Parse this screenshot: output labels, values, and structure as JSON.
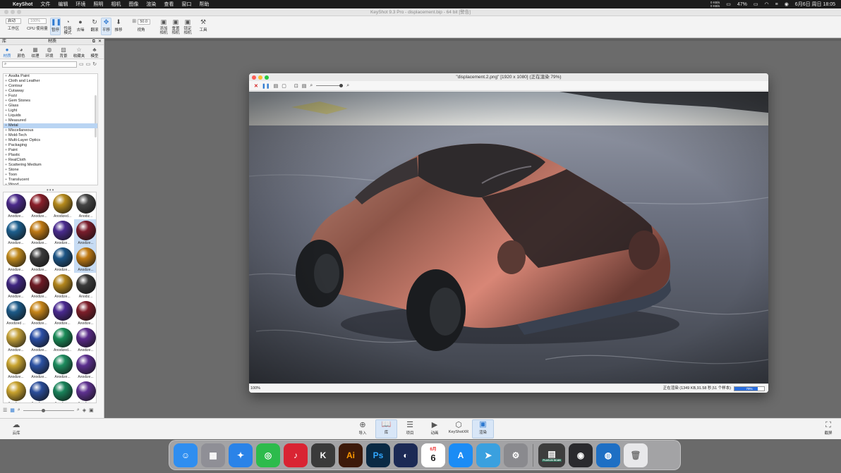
{
  "menubar": {
    "app": "KeyShot",
    "items": [
      "文件",
      "编辑",
      "环境",
      "照明",
      "相机",
      "图像",
      "渲染",
      "查看",
      "窗口",
      "帮助"
    ],
    "right": {
      "net_up": "0 KB/s",
      "net_down": "0 KB/s",
      "battery": "47%",
      "datetime": "6月6日 周日 18:05"
    }
  },
  "window": {
    "title": "KeyShot 9.3 Pro  - displacement.bip  - 64 bit [警告]"
  },
  "toolbar": {
    "workspace_select": "启动",
    "workspace_label": "工作区",
    "cpu_select": "100%",
    "cpu_label": "CPU 使用量",
    "pause_label": "暂停",
    "perf_label": "性能\n模式",
    "denoise_label": "去噪",
    "refresh_label": "翻滚",
    "pan_label": "平移",
    "push_label": "推移",
    "fov_value": "50.0",
    "fov_label": "视角",
    "add_camera_label": "添加\n相机",
    "reset_camera_label": "重置\n相机",
    "lock_camera_label": "锁定\n相机",
    "tools_label": "工具"
  },
  "library": {
    "header_left": "库",
    "header_center": "材质",
    "tabs": [
      "材质",
      "颜色",
      "纹理",
      "环境",
      "背景",
      "收藏夹",
      "模型"
    ],
    "search_placeholder": "",
    "tree": [
      "Axalta Paint",
      "Cloth and Leather",
      "Contour",
      "Cutaway",
      "Fuzz",
      "Gem Stones",
      "Glass",
      "Light",
      "Liquids",
      "Measured",
      "Metal",
      "Miscellaneous",
      "Mold-Tech",
      "Multi-Layer Optics",
      "Packaging",
      "Paint",
      "Plastic",
      "RealCloth",
      "Scattering Medium",
      "Stone",
      "Toon",
      "Translucent",
      "Wood"
    ],
    "selected_tree": "Metal",
    "thumbs": [
      {
        "label": "Anodize...",
        "color": "#4b2a8a"
      },
      {
        "label": "Anodize...",
        "color": "#8a1f2a"
      },
      {
        "label": "Anodized...",
        "color": "#b58a1c"
      },
      {
        "label": "Anodiz...",
        "color": "#444444"
      },
      {
        "label": "Anodize...",
        "color": "#1d5f8e"
      },
      {
        "label": "Anodize...",
        "color": "#c07a14"
      },
      {
        "label": "Anodize...",
        "color": "#4a2b8e"
      },
      {
        "label": "Anodize...",
        "color": "#7a1d2c"
      },
      {
        "label": "Anodize...",
        "color": "#c08a1e"
      },
      {
        "label": "Anodize...",
        "color": "#3b3b3b"
      },
      {
        "label": "Anodize...",
        "color": "#1d5484"
      },
      {
        "label": "Anodize...",
        "color": "#c07a12"
      },
      {
        "label": "Anodize...",
        "color": "#3f2680"
      },
      {
        "label": "Anodize...",
        "color": "#6e1a25"
      },
      {
        "label": "Anodize...",
        "color": "#b3861d"
      },
      {
        "label": "Anodiz...",
        "color": "#3a3a3a"
      },
      {
        "label": "Anodized ...",
        "color": "#1c5a88"
      },
      {
        "label": "Anodize...",
        "color": "#c88618"
      },
      {
        "label": "Anodize...",
        "color": "#4a2a90"
      },
      {
        "label": "Anodize...",
        "color": "#7d1e2a"
      },
      {
        "label": "Anodize...",
        "color": "#c5a23a"
      },
      {
        "label": "Anodize...",
        "color": "#2b4fa6"
      },
      {
        "label": "Anodized...",
        "color": "#1a8a57"
      },
      {
        "label": "Anodize...",
        "color": "#5a2a8a"
      },
      {
        "label": "Anodize...",
        "color": "#c9a531"
      },
      {
        "label": "Anodize...",
        "color": "#2c52a3"
      },
      {
        "label": "Anodize...",
        "color": "#1d8c5e"
      },
      {
        "label": "Anodize...",
        "color": "#5b2f8e"
      },
      {
        "label": "Anodize...",
        "color": "#c8a22e"
      },
      {
        "label": "Anodize...",
        "color": "#2a4d9a"
      },
      {
        "label": "Anodize...",
        "color": "#19835a"
      },
      {
        "label": "Anodize...",
        "color": "#5e3190"
      }
    ],
    "selected_thumbs": [
      7,
      11
    ]
  },
  "render_window": {
    "title": "\"displacement.2.png\" [1920 x 1080] (正在渲染 79%)",
    "zoom": "100%",
    "status": "正在渲染 (1349 KB,91.58 秒,51 个样本)",
    "progress_pct": 79,
    "progress_text": "79%"
  },
  "bottombar": {
    "cloud_label": "云库",
    "import_label": "导入",
    "library_label": "库",
    "project_label": "项目",
    "animation_label": "动画",
    "keyshotxr_label": "KeyShotXR",
    "render_label": "渲染",
    "screenshot_label": "截屏"
  },
  "dock": {
    "apps": [
      {
        "name": "finder",
        "glyph": "☺",
        "color": "#2f8ef0"
      },
      {
        "name": "launchpad",
        "glyph": "▦",
        "color": "#8f8f96"
      },
      {
        "name": "safari",
        "glyph": "✦",
        "color": "#2a83e8"
      },
      {
        "name": "wechat",
        "glyph": "◎",
        "color": "#2dbb4c"
      },
      {
        "name": "netease-music",
        "glyph": "♪",
        "color": "#d92433"
      },
      {
        "name": "keyshot",
        "glyph": "K",
        "color": "#3a3a3a"
      },
      {
        "name": "illustrator",
        "glyph": "Ai",
        "color": "#3d1a0a",
        "text": "#ff9a00"
      },
      {
        "name": "photoshop",
        "glyph": "Ps",
        "color": "#0a2a44",
        "text": "#31a8ff"
      },
      {
        "name": "cinema4d",
        "glyph": "◐",
        "color": "#1c2a55"
      },
      {
        "name": "calendar",
        "glyph": "6",
        "color": "#ffffff",
        "text": "#222222",
        "month": "6月"
      },
      {
        "name": "app-store",
        "glyph": "A",
        "color": "#1b8cf5"
      },
      {
        "name": "telegram",
        "glyph": "➤",
        "color": "#3aa0df"
      },
      {
        "name": "system-preferences",
        "glyph": "⚙",
        "color": "#8a8a8e"
      }
    ],
    "right_apps": [
      {
        "name": "plugin-scan",
        "glyph": "▤",
        "color": "#3d3d3d",
        "label": "PLUG-IN SCAN"
      },
      {
        "name": "davinci-resolve",
        "glyph": "◉",
        "color": "#2a2a2e"
      },
      {
        "name": "keyshot-viewer",
        "glyph": "◍",
        "color": "#1e6fc4"
      },
      {
        "name": "trash",
        "glyph": "🗑",
        "color": "#e8e8ea",
        "text": "#777777"
      }
    ]
  }
}
